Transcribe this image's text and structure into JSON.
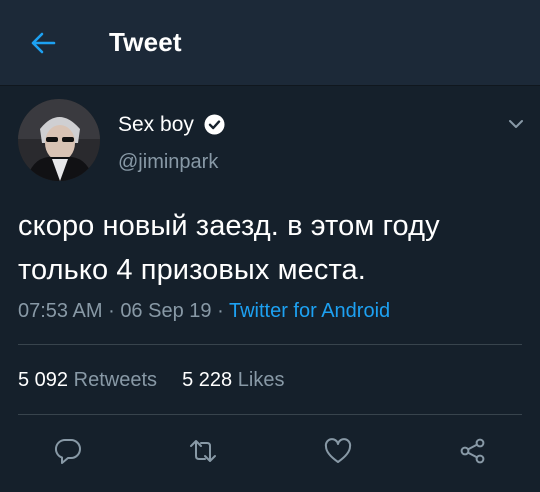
{
  "header": {
    "title": "Tweet"
  },
  "tweet": {
    "author_name": "Sex boy",
    "handle": "@jiminpark",
    "text_line1": "скоро новый заезд. в этом году",
    "text_line2": "только 4 призовых места.",
    "time": "07:53 AM",
    "date": "06 Sep 19",
    "source": "Twitter for Android",
    "separator": "·"
  },
  "stats": {
    "retweets_count": "5 092",
    "retweets_label": "Retweets",
    "likes_count": "5 228",
    "likes_label": "Likes"
  },
  "colors": {
    "background": "#15202b",
    "topbar": "#1c2938",
    "accent": "#1da1f2",
    "secondary_text": "#8899a6"
  },
  "icons": [
    "back-arrow-icon",
    "verified-badge-icon",
    "chevron-down-icon",
    "reply-icon",
    "retweet-icon",
    "like-icon",
    "share-icon"
  ]
}
